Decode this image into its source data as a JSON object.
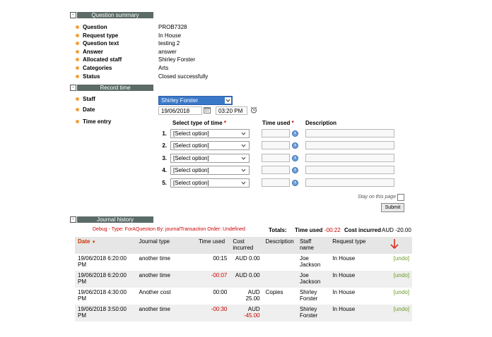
{
  "question_summary": {
    "title": "Question summary",
    "toggle": "-",
    "fields": [
      {
        "label": "Question",
        "value": "PROB7328"
      },
      {
        "label": "Request type",
        "value": "In House"
      },
      {
        "label": "Question text",
        "value": "testing 2"
      },
      {
        "label": "Answer",
        "value": "answer"
      },
      {
        "label": "Allocated staff",
        "value": "Shirley Forster"
      },
      {
        "label": "Categories",
        "value": "Arts"
      },
      {
        "label": "Status",
        "value": "Closed successfully"
      }
    ]
  },
  "record_time": {
    "title": "Record time",
    "toggle": "-",
    "staff_label": "Staff",
    "staff_value": "Shirley Forster",
    "date_label": "Date",
    "date_value": "19/06/2018",
    "time_value": "03:20 PM",
    "time_entry_label": "Time entry",
    "col_type": "Select type of time",
    "col_used": "Time used",
    "col_desc": "Description",
    "required_mark": "*",
    "rows": [
      {
        "num": "1.",
        "option": "[Select option]"
      },
      {
        "num": "2.",
        "option": "[Select option]"
      },
      {
        "num": "3.",
        "option": "[Select option]"
      },
      {
        "num": "4.",
        "option": "[Select option]"
      },
      {
        "num": "5.",
        "option": "[Select option]"
      }
    ],
    "stay_label": "Stay on this page",
    "submit_label": "Submit"
  },
  "journal": {
    "title": "Journal history",
    "toggle": "-",
    "debug": "Debug - Type: ForAQuestion By: journalTransaction Order: Undefined",
    "totals_label": "Totals:",
    "time_used_label": "Time used",
    "time_used_value": "-00:22",
    "cost_label": "Cost incurred",
    "cost_value": "AUD -20.00",
    "headers": [
      "Date",
      "Journal type",
      "Time used",
      "Cost incurred",
      "Description",
      "Staff name",
      "Request type"
    ],
    "sort_arrow": "▼",
    "rows": [
      {
        "date": "19/06/2018 6:20:00 PM",
        "type": "another time",
        "time": "00:15",
        "time_neg": false,
        "cost_cur": "AUD",
        "cost": "0.00",
        "cost_neg": false,
        "desc": "",
        "staff": "Joe Jackson",
        "req": "In House",
        "action": "[undo]"
      },
      {
        "date": "19/06/2018 6:20:00 PM",
        "type": "another time",
        "time": "-00:07",
        "time_neg": true,
        "cost_cur": "AUD",
        "cost": "0.00",
        "cost_neg": false,
        "desc": "",
        "staff": "Joe Jackson",
        "req": "In House",
        "action": "[undo]"
      },
      {
        "date": "19/06/2018 4:30:00 PM",
        "type": "Another cost",
        "time": "00:00",
        "time_neg": false,
        "cost_cur": "AUD",
        "cost": "25.00",
        "cost_neg": false,
        "desc": "Copies",
        "staff": "Shirley Forster",
        "req": "In House",
        "action": "[undo]"
      },
      {
        "date": "19/06/2018 3:50:00 PM",
        "type": "another time",
        "time": "-00:30",
        "time_neg": true,
        "cost_cur": "AUD",
        "cost": "-45.00",
        "cost_neg": true,
        "desc": "",
        "staff": "Shirley Forster",
        "req": "In House",
        "action": "[undo]"
      }
    ]
  },
  "colors": {
    "accent": "#f0a03c",
    "section_bar": "#5b6b67",
    "negative": "#cc0000",
    "undo": "#6a9a1e"
  }
}
